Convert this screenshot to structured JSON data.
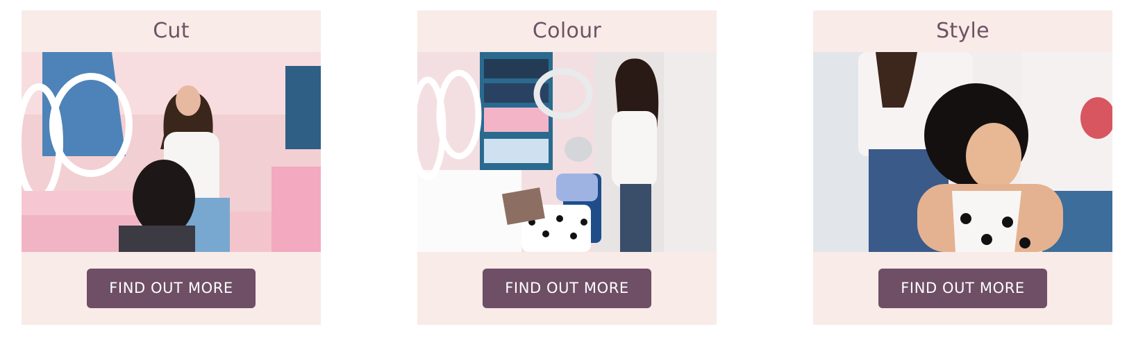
{
  "services": [
    {
      "title": "Cut",
      "image": "hair-cutting-salon-photo",
      "button_label": "FIND OUT MORE"
    },
    {
      "title": "Colour",
      "image": "hair-colouring-salon-photo",
      "button_label": "FIND OUT MORE"
    },
    {
      "title": "Style",
      "image": "hair-styling-salon-photo",
      "button_label": "FIND OUT MORE"
    }
  ],
  "colors": {
    "card_background": "#f8ebe8",
    "title_text": "#6f5264",
    "button_background": "#6e4f66",
    "button_text": "#ffffff"
  }
}
